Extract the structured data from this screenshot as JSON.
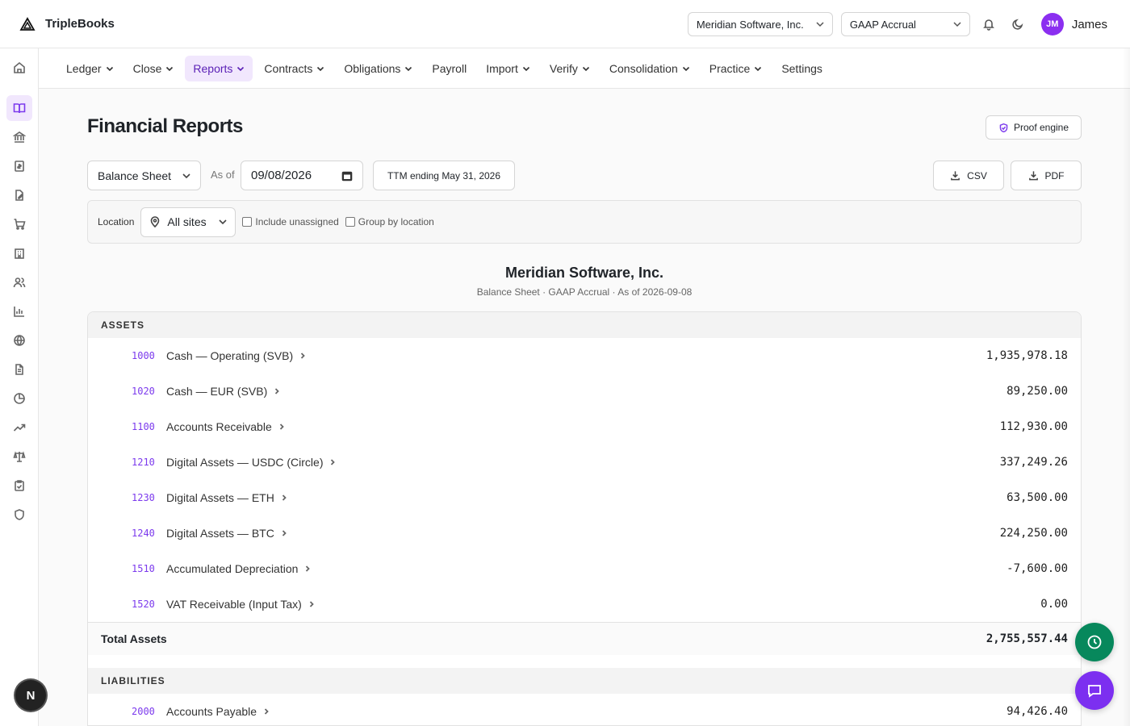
{
  "app": {
    "name": "TripleBooks"
  },
  "header": {
    "org_select": "Meridian Software, Inc.",
    "basis_select": "GAAP Accrual",
    "user_initials": "JM",
    "user_name": "James"
  },
  "nav": {
    "items": [
      {
        "label": "Ledger",
        "dropdown": true
      },
      {
        "label": "Close",
        "dropdown": true
      },
      {
        "label": "Reports",
        "dropdown": true,
        "active": true
      },
      {
        "label": "Contracts",
        "dropdown": true
      },
      {
        "label": "Obligations",
        "dropdown": true
      },
      {
        "label": "Payroll",
        "dropdown": false
      },
      {
        "label": "Import",
        "dropdown": true
      },
      {
        "label": "Verify",
        "dropdown": true
      },
      {
        "label": "Consolidation",
        "dropdown": true
      },
      {
        "label": "Practice",
        "dropdown": true
      },
      {
        "label": "Settings",
        "dropdown": false
      }
    ]
  },
  "sidebar": {
    "icons": [
      "home-icon",
      "book-open-icon",
      "bank-icon",
      "receipt-icon",
      "file-edit-icon",
      "cart-icon",
      "building-icon",
      "users-icon",
      "bar-chart-icon",
      "globe-icon",
      "document-icon",
      "pie-chart-icon",
      "trending-up-icon",
      "scale-icon",
      "clipboard-check-icon",
      "shield-icon"
    ],
    "active_index": 1,
    "bottom_badge": "N"
  },
  "page": {
    "title": "Financial Reports",
    "proof_button": "Proof engine",
    "report_type": "Balance Sheet",
    "as_of_label": "As of",
    "as_of_date": "09/08/2026",
    "ttm_button": "TTM ending May 31, 2026",
    "csv_button": "CSV",
    "pdf_button": "PDF"
  },
  "filters": {
    "location_label": "Location",
    "location_value": "All sites",
    "include_unassigned": "Include unassigned",
    "group_by_location": "Group by location"
  },
  "report": {
    "company": "Meridian Software, Inc.",
    "subtitle": "Balance Sheet · GAAP Accrual · As of 2026-09-08",
    "assets_header": "ASSETS",
    "assets": [
      {
        "code": "1000",
        "name": "Cash — Operating (SVB)",
        "amount": "1,935,978.18"
      },
      {
        "code": "1020",
        "name": "Cash — EUR (SVB)",
        "amount": "89,250.00"
      },
      {
        "code": "1100",
        "name": "Accounts Receivable",
        "amount": "112,930.00"
      },
      {
        "code": "1210",
        "name": "Digital Assets — USDC (Circle)",
        "amount": "337,249.26"
      },
      {
        "code": "1230",
        "name": "Digital Assets — ETH",
        "amount": "63,500.00"
      },
      {
        "code": "1240",
        "name": "Digital Assets — BTC",
        "amount": "224,250.00"
      },
      {
        "code": "1510",
        "name": "Accumulated Depreciation",
        "amount": "-7,600.00"
      },
      {
        "code": "1520",
        "name": "VAT Receivable (Input Tax)",
        "amount": "0.00"
      }
    ],
    "total_assets_label": "Total Assets",
    "total_assets": "2,755,557.44",
    "liabilities_header": "LIABILITIES",
    "liabilities": [
      {
        "code": "2000",
        "name": "Accounts Payable",
        "amount": "94,426.40"
      }
    ]
  },
  "colors": {
    "accent": "#7c3aed",
    "green_fab": "#07885c",
    "purple_fab": "#7c2ff0"
  }
}
